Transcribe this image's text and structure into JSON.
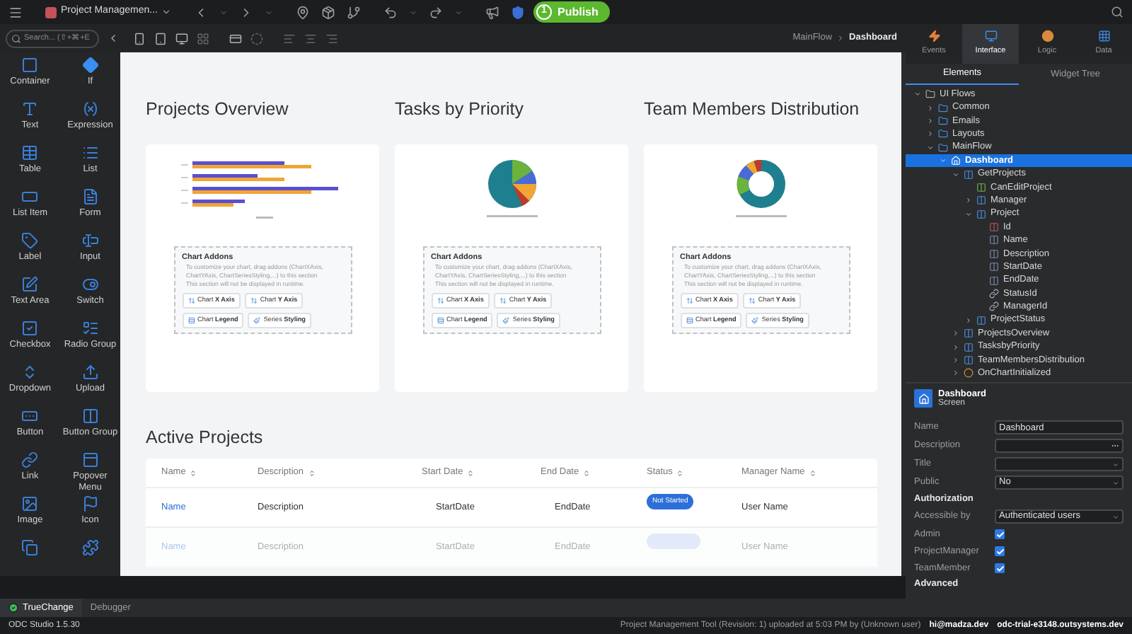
{
  "top_bar": {
    "project": "Project Managemen...",
    "publish": {
      "badge": "1",
      "label": "Publish"
    }
  },
  "toolbox": {
    "search": {
      "placeholder": "Search... (⇧+⌘+E"
    },
    "items": [
      {
        "label": "Container"
      },
      {
        "label": "If"
      },
      {
        "label": "Text"
      },
      {
        "label": "Expression"
      },
      {
        "label": "Table"
      },
      {
        "label": "List"
      },
      {
        "label": "List Item"
      },
      {
        "label": "Form"
      },
      {
        "label": "Label"
      },
      {
        "label": "Input"
      },
      {
        "label": "Text Area"
      },
      {
        "label": "Switch"
      },
      {
        "label": "Checkbox"
      },
      {
        "label": "Radio Group"
      },
      {
        "label": "Dropdown"
      },
      {
        "label": "Upload"
      },
      {
        "label": "Button"
      },
      {
        "label": "Button Group"
      },
      {
        "label": "Link"
      },
      {
        "label": "Popover Menu"
      },
      {
        "label": "Image"
      },
      {
        "label": "Icon"
      }
    ]
  },
  "canvas": {
    "breadcrumb": {
      "parent": "MainFlow",
      "current": "Dashboard"
    },
    "charts": [
      {
        "title": "Projects Overview",
        "kind": "bar",
        "addons": {
          "title": "Chart Addons",
          "hint": "To customize your chart, drag addons (ChartXAxis, ChartYAxis, ChartSeriesStyling,...) to this section",
          "note": "This section will not be displayed in runtime.",
          "buttons": [
            "Chart **X Axis**",
            "Chart **Y Axis**",
            "Chart **Legend**",
            "Series **Styling**"
          ]
        }
      },
      {
        "title": "Tasks by Priority",
        "kind": "pie",
        "addons": {
          "title": "Chart Addons",
          "hint": "To customize your chart, drag addons (ChartXAxis, ChartYAxis, ChartSeriesStyling,...) to this section",
          "note": "This section will not be displayed in runtime.",
          "buttons": [
            "Chart **X Axis**",
            "Chart **Y Axis**",
            "Chart **Legend**",
            "Series **Styling**"
          ]
        }
      },
      {
        "title": "Team Members Distribution",
        "kind": "donut",
        "addons": {
          "title": "Chart Addons",
          "hint": "To customize your chart, drag addons (ChartXAxis, ChartYAxis, ChartSeriesStyling,...) to this section",
          "note": "This section will not be displayed in runtime.",
          "buttons": [
            "Chart **X Axis**",
            "Chart **Y Axis**",
            "Chart **Legend**",
            "Series **Styling**"
          ]
        }
      }
    ],
    "table": {
      "title": "Active Projects",
      "columns": [
        "Name",
        "Description",
        "Start Date",
        "End Date",
        "Status",
        "Manager Name"
      ],
      "rows": [
        {
          "faded": false,
          "name": "Name",
          "description": "Description",
          "start": "StartDate",
          "end": "EndDate",
          "status": "Not Started",
          "manager": "User Name"
        },
        {
          "faded": true,
          "name": "Name",
          "description": "Description",
          "start": "StartDate",
          "end": "EndDate",
          "manager": "User Name"
        }
      ]
    }
  },
  "right_panel": {
    "tabs": [
      {
        "label": "Events",
        "selected": false
      },
      {
        "label": "Interface",
        "selected": true
      },
      {
        "label": "Logic",
        "selected": false
      },
      {
        "label": "Data",
        "selected": false
      }
    ],
    "subtabs": [
      {
        "label": "Elements",
        "selected": true
      },
      {
        "label": "Widget Tree",
        "selected": false
      }
    ],
    "tree": [
      {
        "label": "UI Flows",
        "kind": "folder",
        "expanded": true,
        "selected": false,
        "children": [
          {
            "label": "Common",
            "kind": "flow",
            "expanded": false,
            "selected": false
          },
          {
            "label": "Emails",
            "kind": "flow",
            "expanded": false,
            "selected": false
          },
          {
            "label": "Layouts",
            "kind": "flow",
            "expanded": false,
            "selected": false
          },
          {
            "label": "MainFlow",
            "kind": "flow",
            "expanded": true,
            "selected": false,
            "children": [
              {
                "label": "Dashboard",
                "kind": "screen",
                "expanded": true,
                "selected": true,
                "children": [
                  {
                    "label": "GetProjects",
                    "kind": "aggregate",
                    "expanded": true,
                    "selected": false,
                    "children": [
                      {
                        "label": "CanEditProject",
                        "kind": "boolean",
                        "selected": false
                      },
                      {
                        "label": "Manager",
                        "kind": "entity",
                        "expanded": false,
                        "selected": false
                      },
                      {
                        "label": "Project",
                        "kind": "entity",
                        "expanded": true,
                        "selected": false,
                        "children": [
                          {
                            "label": "Id",
                            "kind": "id",
                            "selected": false
                          },
                          {
                            "label": "Name",
                            "kind": "attribute",
                            "selected": false
                          },
                          {
                            "label": "Description",
                            "kind": "attribute",
                            "selected": false
                          },
                          {
                            "label": "StartDate",
                            "kind": "attribute",
                            "selected": false
                          },
                          {
                            "label": "EndDate",
                            "kind": "attribute",
                            "selected": false
                          },
                          {
                            "label": "StatusId",
                            "kind": "reference",
                            "selected": false
                          },
                          {
                            "label": "ManagerId",
                            "kind": "reference",
                            "selected": false
                          }
                        ]
                      },
                      {
                        "label": "ProjectStatus",
                        "kind": "entity",
                        "expanded": false,
                        "selected": false
                      }
                    ]
                  },
                  {
                    "label": "ProjectsOverview",
                    "kind": "aggregate",
                    "expanded": false,
                    "selected": false
                  },
                  {
                    "label": "TasksbyPriority",
                    "kind": "aggregate",
                    "expanded": false,
                    "selected": false
                  },
                  {
                    "label": "TeamMembersDistribution",
                    "kind": "aggregate",
                    "expanded": false,
                    "selected": false
                  },
                  {
                    "label": "OnChartInitialized",
                    "kind": "action",
                    "expanded": false,
                    "selected": false
                  }
                ]
              }
            ]
          }
        ]
      }
    ],
    "properties": {
      "title": "Dashboard",
      "subtitle": "Screen",
      "fields": [
        {
          "kind": "text",
          "label": "Name",
          "value": "Dashboard"
        },
        {
          "kind": "more",
          "label": "Description"
        },
        {
          "kind": "select",
          "label": "Title"
        },
        {
          "kind": "select",
          "label": "Public",
          "value": "No"
        },
        {
          "kind": "heading",
          "label": "Authorization"
        },
        {
          "kind": "select",
          "label": "Accessible by",
          "value": "Authenticated users"
        },
        {
          "kind": "check",
          "label": "Admin",
          "checked": true
        },
        {
          "kind": "check",
          "label": "ProjectManager",
          "checked": true
        },
        {
          "kind": "check",
          "label": "TeamMember",
          "checked": true
        },
        {
          "kind": "heading",
          "label": "Advanced"
        }
      ]
    }
  },
  "debug_bar": {
    "tabs": [
      {
        "label": "TrueChange",
        "selected": true
      },
      {
        "label": "Debugger",
        "selected": false
      }
    ]
  },
  "status_bar": {
    "version": "ODC Studio 1.5.30",
    "message": "Project Management Tool (Revision: 1) uploaded at 5:03 PM by (Unknown user)",
    "user": "hi@madza.dev",
    "environment": "odc-trial-e3148.outsystems.dev"
  }
}
